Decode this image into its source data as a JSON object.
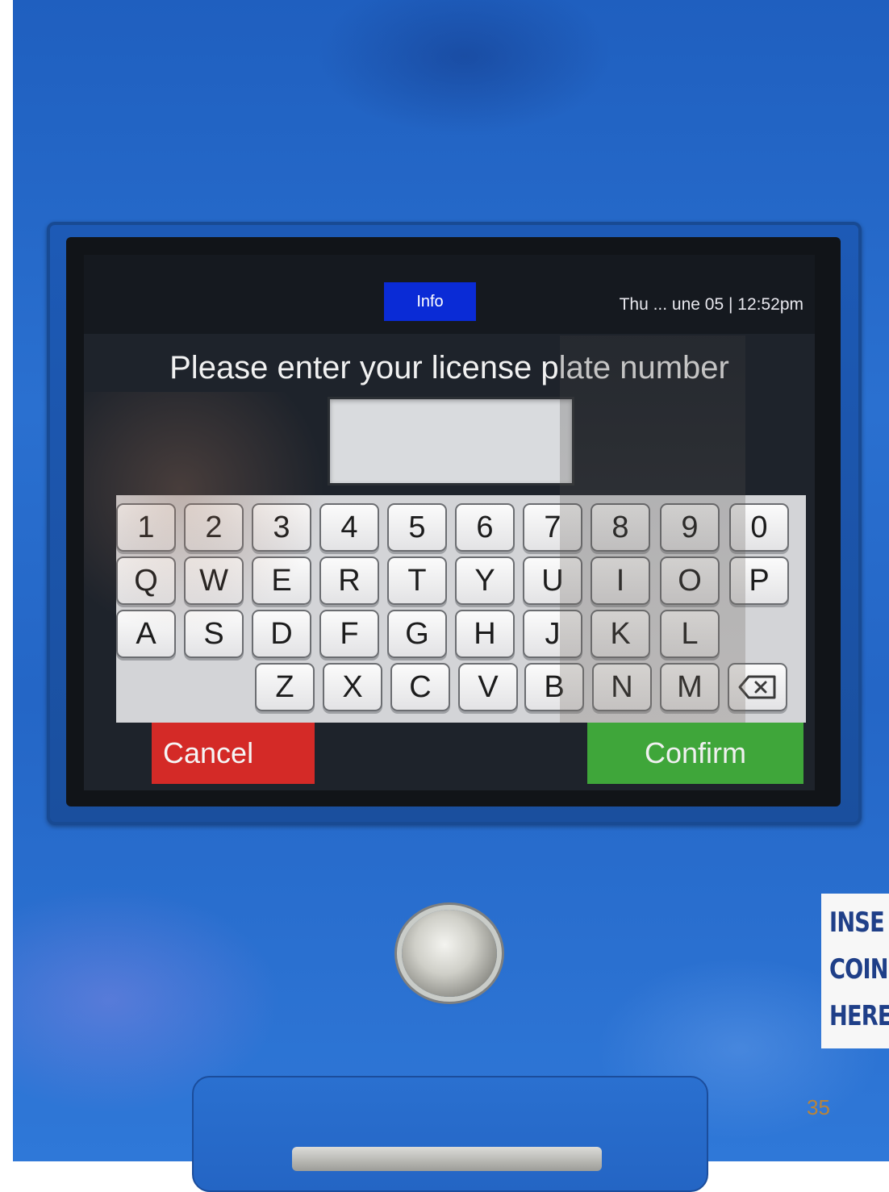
{
  "kiosk": {
    "info_button": "Info",
    "datetime": "Thu ... une 05 | 12:52pm",
    "prompt": "Please enter your license plate number",
    "plate_value": "",
    "keyboard": {
      "row1": [
        "1",
        "2",
        "3",
        "4",
        "5",
        "6",
        "7",
        "8",
        "9",
        "0"
      ],
      "row2": [
        "Q",
        "W",
        "E",
        "R",
        "T",
        "Y",
        "U",
        "I",
        "O",
        "P"
      ],
      "row3": [
        "A",
        "S",
        "D",
        "F",
        "G",
        "H",
        "J",
        "K",
        "L"
      ],
      "row4": [
        "Z",
        "X",
        "C",
        "V",
        "B",
        "N",
        "M"
      ],
      "backspace_icon": "backspace-icon"
    },
    "cancel_label": "Cancel",
    "confirm_label": "Confirm"
  },
  "coin_sticker": {
    "line1": "INSE",
    "line2": "COIN",
    "line3": "HERE"
  },
  "slide_number": "35",
  "colors": {
    "machine_blue": "#2a70d0",
    "info_blue": "#0a2bd6",
    "cancel_red": "#d42a27",
    "confirm_green": "#3fa63a"
  }
}
